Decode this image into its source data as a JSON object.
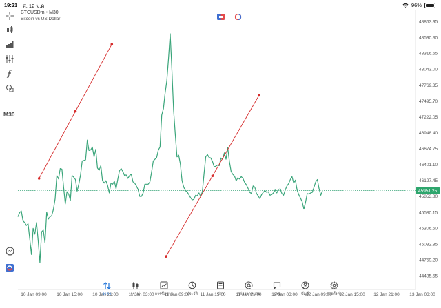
{
  "status_bar": {
    "time": "19:21",
    "date": "ศ. 12 ม.ค.",
    "battery": "96%",
    "battery_level": 0.96
  },
  "header": {
    "symbol": "BTCUSDm",
    "separator": "•",
    "timeframe": "M30",
    "description": "Bitcoin vs US Dollar"
  },
  "toolbar": {
    "timeframe_label": "M30",
    "icons": [
      "crosshair-icon",
      "candlestick-icon",
      "bar-chart-icon",
      "indicators-icon",
      "function-icon",
      "shapes-icon",
      "clock-icon",
      "brand-icon"
    ]
  },
  "colors": {
    "price_line": "#3aa57a",
    "trend_line": "#d62b2b",
    "current_price_bg": "#2ea66d",
    "accent": "#1e73d8"
  },
  "chart_data": {
    "type": "line",
    "title": "",
    "xlabel": "",
    "ylabel": "",
    "ylim": [
      44485.55,
      48863.95
    ],
    "y_ticks": [
      "48863.95",
      "48590.30",
      "48316.65",
      "48043.00",
      "47769.35",
      "47495.70",
      "47222.05",
      "46948.40",
      "46674.75",
      "46401.10",
      "46127.45",
      "45853.80",
      "45580.15",
      "45306.50",
      "45032.85",
      "44759.20",
      "44485.55"
    ],
    "current_price": "45951.25",
    "x_ticks": [
      "10 Jan 09:00",
      "10 Jan 15:00",
      "10 Jan 21:00",
      "11 Jan 03:00",
      "11 Jan 09:00",
      "11 Jan 15:00",
      "11 Jan 21:00",
      "12 Jan 03:00",
      "12 Jan 09:00",
      "12 Jan 15:00",
      "12 Jan 21:00",
      "13 Jan 03:00"
    ],
    "x_range": [
      0,
      65
    ],
    "series": [
      {
        "values": [
          45500,
          45570,
          45600,
          45430,
          45400,
          45350,
          45380,
          45120,
          44850,
          45300,
          45200,
          45400,
          45080,
          44710,
          45240,
          45270,
          45050,
          45580,
          45460,
          45500,
          45520,
          45630,
          45810,
          46210,
          46150,
          46330,
          46320,
          46010,
          45720,
          45930,
          45890,
          45780,
          46210,
          46180,
          46140,
          45940,
          46060,
          46220,
          46460,
          46470,
          46480,
          46820,
          46640,
          46650,
          46700,
          46530,
          46660,
          46340,
          46300,
          46380,
          46120,
          46080,
          46120,
          46040,
          45910,
          46080,
          46060,
          46110,
          45980,
          46140,
          46290,
          46330,
          46280,
          46210,
          46220,
          46160,
          46210,
          46230,
          46100,
          46080,
          46030,
          45970,
          45850,
          45850,
          45910,
          46060,
          46060,
          46060,
          46100,
          46270,
          46460,
          46490,
          46520,
          46650,
          46700,
          47250,
          47360,
          47630,
          47840,
          48220,
          48650,
          48030,
          47340,
          46920,
          46530,
          46560,
          46410,
          46120,
          46010,
          45950,
          45930,
          45880,
          45830,
          45790,
          45800,
          45870,
          45860,
          45910,
          45850,
          45930,
          46240,
          46530,
          46570,
          46520,
          46510,
          46450,
          46360,
          46370,
          46390,
          46380,
          46510,
          46490,
          46600,
          46490,
          46690,
          46450,
          46280,
          46230,
          46200,
          46120,
          46170,
          46150,
          46190,
          46160,
          46090,
          46050,
          45990,
          45920,
          45900,
          46030,
          46010,
          45900,
          45860,
          45810,
          45880,
          45920,
          45950,
          45920,
          45930,
          45870,
          45880,
          45910,
          45960,
          45910,
          45970,
          45980,
          45900,
          45870,
          45960,
          46030,
          46070,
          46140,
          46190,
          46080,
          46130,
          45960,
          45880,
          45820,
          45760,
          45630,
          45750,
          45900,
          45890,
          45910,
          45920,
          46010,
          46100,
          46140,
          45980,
          45870,
          45950
        ]
      }
    ],
    "trend_lines": [
      {
        "from": [
          12.5,
          46160
        ],
        "to": [
          55.5,
          48470
        ]
      },
      {
        "from": [
          87.5,
          44815
        ],
        "to": [
          142.5,
          47590
        ]
      }
    ]
  },
  "tabs": [
    {
      "label": "ราคา",
      "icon": "sort-arrows-icon",
      "active": true
    },
    {
      "label": "กราฟ",
      "icon": "candles-icon",
      "active": false
    },
    {
      "label": "การซื้อขาย",
      "icon": "trade-chart-icon",
      "active": false
    },
    {
      "label": "ประวัติ",
      "icon": "history-icon",
      "active": false
    },
    {
      "label": "ข่าว",
      "icon": "news-icon",
      "active": false
    },
    {
      "label": "กล่องจดหมาย",
      "icon": "at-icon",
      "active": false
    },
    {
      "label": "แชท",
      "icon": "chat-icon",
      "active": false
    },
    {
      "label": "บัญชี",
      "icon": "account-icon",
      "active": false
    },
    {
      "label": "การตั้งค่า",
      "icon": "settings-icon",
      "active": false
    }
  ]
}
